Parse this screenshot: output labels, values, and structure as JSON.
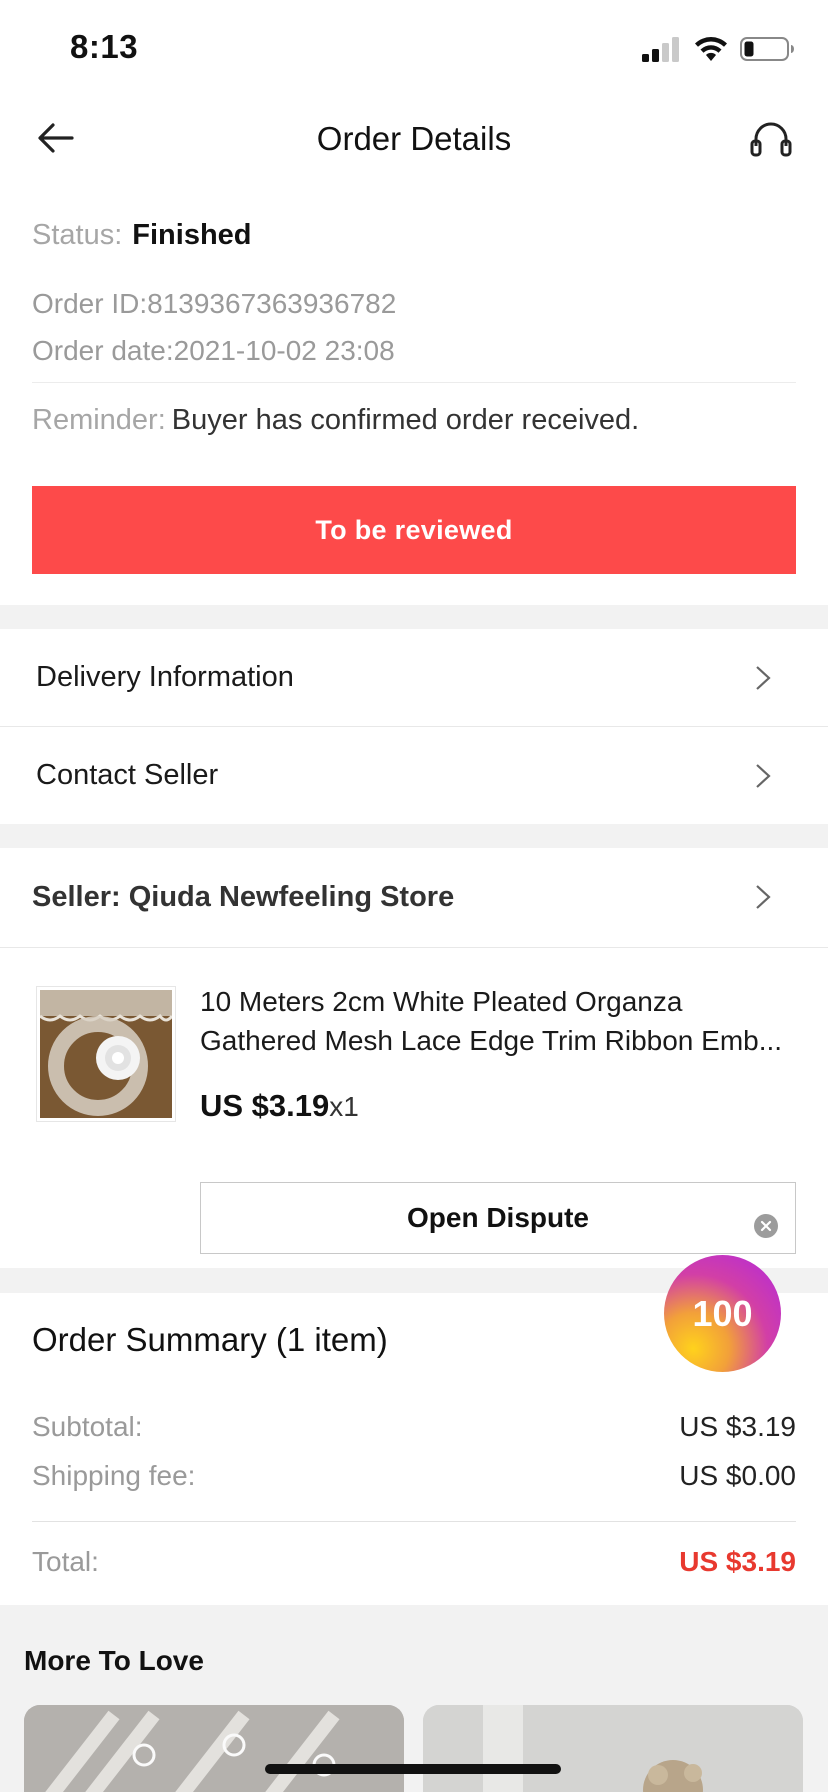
{
  "status_bar": {
    "time": "8:13"
  },
  "nav": {
    "title": "Order Details",
    "back_icon": "arrow-left-icon",
    "support_icon": "headset-icon"
  },
  "order": {
    "status_label": "Status:",
    "status_value": "Finished",
    "order_id": "Order ID:8139367363936782",
    "order_date": "Order date:2021-10-02 23:08",
    "reminder_label": "Reminder:",
    "reminder_text": "Buyer has confirmed order received."
  },
  "review_button": "To be reviewed",
  "menu": {
    "delivery": "Delivery Information",
    "contact": "Contact Seller"
  },
  "seller": {
    "label": "Seller: Qiuda Newfeeling Store"
  },
  "product": {
    "title_line1": "10 Meters 2cm White Pleated Organza",
    "title_line2": "Gathered Mesh Lace Edge Trim Ribbon Emb...",
    "price": "US $3.19",
    "qty": "x1",
    "dispute_button": "Open Dispute"
  },
  "summary": {
    "title": "Order Summary (1 item)",
    "subtotal_label": "Subtotal:",
    "subtotal_value": "US $3.19",
    "shipping_label": "Shipping fee:",
    "shipping_value": "US $0.00",
    "total_label": "Total:",
    "total_value": "US $3.19"
  },
  "floating_badge": {
    "text": "100"
  },
  "more": {
    "title": "More To Love"
  },
  "colors": {
    "accent": "#fd4a4a",
    "total": "#e8392f"
  }
}
